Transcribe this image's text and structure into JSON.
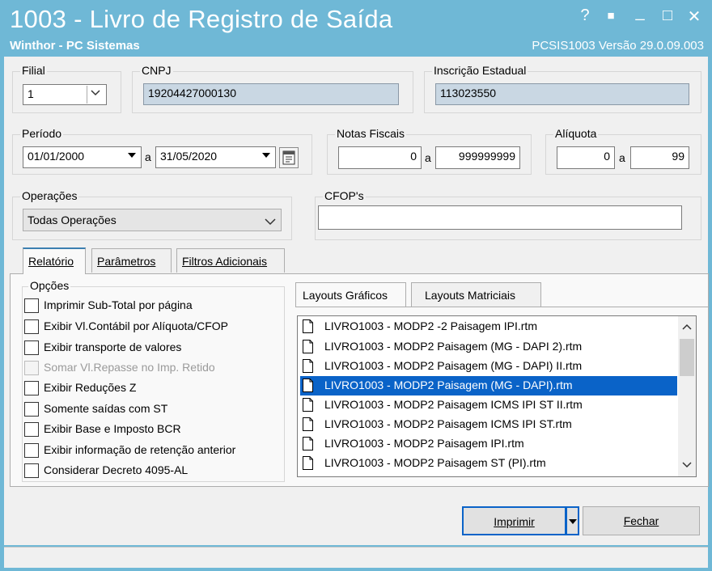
{
  "window": {
    "title": "1003 - Livro de Registro de Saída",
    "subtitle": "Winthor - PC Sistemas",
    "version": "PCSIS1003  Versão  29.0.09.003",
    "controls": [
      "?",
      "■",
      "_",
      "□",
      "✕"
    ]
  },
  "filial": {
    "label": "Filial",
    "value": "1"
  },
  "cnpj": {
    "label": "CNPJ",
    "value": "19204427000130"
  },
  "ie": {
    "label": "Inscrição Estadual",
    "value": "113023550"
  },
  "periodo": {
    "label": "Período",
    "from": "01/01/2000",
    "sep": "a",
    "to": "31/05/2020"
  },
  "notas": {
    "label": "Notas Fiscais",
    "from": "0",
    "sep": "a",
    "to": "999999999"
  },
  "aliquota": {
    "label": "Alíquota",
    "from": "0",
    "sep": "a",
    "to": "99"
  },
  "operacoes": {
    "label": "Operações",
    "value": "Todas Operações"
  },
  "cfop": {
    "label": "CFOP's",
    "value": ""
  },
  "tabs": [
    "Relatório",
    "Parâmetros",
    "Filtros Adicionais"
  ],
  "opcoes": {
    "label": "Opções",
    "items": [
      {
        "label": "Imprimir Sub-Total por página",
        "checked": false,
        "enabled": true
      },
      {
        "label": "Exibir Vl.Contábil por Alíquota/CFOP",
        "checked": false,
        "enabled": true
      },
      {
        "label": "Exibir transporte de valores",
        "checked": false,
        "enabled": true
      },
      {
        "label": "Somar Vl.Repasse no Imp. Retido",
        "checked": false,
        "enabled": false
      },
      {
        "label": "Exibir Reduções Z",
        "checked": false,
        "enabled": true
      },
      {
        "label": "Somente saídas com ST",
        "checked": false,
        "enabled": true
      },
      {
        "label": "Exibir Base e Imposto BCR",
        "checked": false,
        "enabled": true
      },
      {
        "label": "Exibir informação de retenção anterior",
        "checked": false,
        "enabled": true
      },
      {
        "label": "Considerar Decreto 4095-AL",
        "checked": false,
        "enabled": true
      }
    ]
  },
  "layout_tabs": [
    "Layouts Gráficos",
    "Layouts Matriciais"
  ],
  "layouts": [
    "LIVRO1003 - MODP2 -2 Paisagem IPI.rtm",
    "LIVRO1003 - MODP2 Paisagem (MG - DAPI 2).rtm",
    "LIVRO1003 - MODP2 Paisagem (MG - DAPI) II.rtm",
    "LIVRO1003 - MODP2 Paisagem (MG - DAPI).rtm",
    "LIVRO1003 - MODP2 Paisagem ICMS IPI ST II.rtm",
    "LIVRO1003 - MODP2 Paisagem ICMS IPI ST.rtm",
    "LIVRO1003 - MODP2 Paisagem IPI.rtm",
    "LIVRO1003 - MODP2 Paisagem ST (PI).rtm"
  ],
  "selected_layout": "LIVRO1003 - MODP2 Paisagem (MG - DAPI).rtm",
  "buttons": {
    "imprimir": "Imprimir",
    "fechar": "Fechar"
  },
  "colors": {
    "titlebar": "#6fb8d6",
    "selection": "#0a63c8",
    "readonly": "#c9d7e3"
  }
}
